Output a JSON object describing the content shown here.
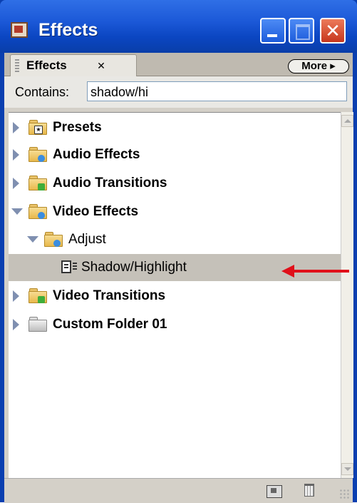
{
  "window": {
    "title": "Effects",
    "title_icon": "effects-app-icon",
    "buttons": [
      "minimize",
      "maximize",
      "close"
    ],
    "close_glyph": "✕"
  },
  "panel": {
    "tab_label": "Effects",
    "tab_close_glyph": "✕",
    "more_label": "More ▸"
  },
  "search": {
    "label": "Contains:",
    "value": "shadow/hi"
  },
  "tree": [
    {
      "label": "Presets",
      "state": "collapsed",
      "level": 0,
      "icon": "preset-folder-icon",
      "bold": true
    },
    {
      "label": "Audio Effects",
      "state": "collapsed",
      "level": 0,
      "icon": "effects-folder-icon",
      "bold": true
    },
    {
      "label": "Audio Transitions",
      "state": "collapsed",
      "level": 0,
      "icon": "transitions-folder-icon",
      "bold": true
    },
    {
      "label": "Video Effects",
      "state": "expanded",
      "level": 0,
      "icon": "effects-folder-icon",
      "bold": true
    },
    {
      "label": "Adjust",
      "state": "expanded",
      "level": 1,
      "icon": "effects-folder-icon",
      "bold": false
    },
    {
      "label": "Shadow/Highlight",
      "state": "leaf",
      "level": 2,
      "icon": "video-effect-icon",
      "bold": false,
      "selected": true
    },
    {
      "label": "Video Transitions",
      "state": "collapsed",
      "level": 0,
      "icon": "transitions-folder-icon",
      "bold": true
    },
    {
      "label": "Custom Folder 01",
      "state": "collapsed",
      "level": 0,
      "icon": "custom-folder-icon",
      "bold": true
    }
  ],
  "footer": {
    "icons": [
      "new-custom-bin-icon",
      "delete-icon",
      "resize-grip-icon"
    ]
  },
  "annotation": {
    "color": "#e0101a",
    "points_to": "Shadow/Highlight"
  },
  "colors": {
    "titlebar": "#1c59d8",
    "panel": "#d4d0c8",
    "selection": "#c5c1b9",
    "close_button": "#c7371d"
  }
}
